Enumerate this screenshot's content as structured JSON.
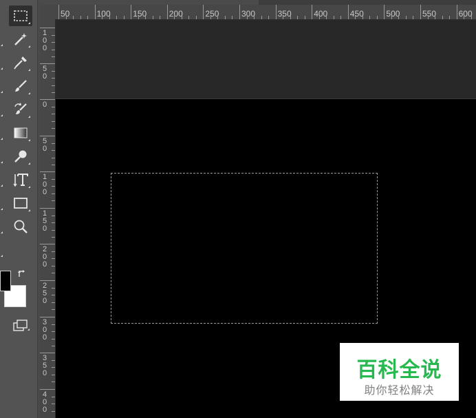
{
  "toolbar": {
    "tools": [
      {
        "name": "rectangular-marquee-tool",
        "icon": "marquee-icon",
        "active": true
      },
      {
        "name": "magic-wand-tool",
        "icon": "magic-wand-icon"
      },
      {
        "name": "eyedropper-tool",
        "icon": "eyedropper-icon"
      },
      {
        "name": "brush-tool",
        "icon": "brush-icon"
      },
      {
        "name": "history-brush-tool",
        "icon": "history-brush-icon"
      },
      {
        "name": "gradient-tool",
        "icon": "gradient-icon"
      },
      {
        "name": "dodge-tool",
        "icon": "dodge-icon"
      },
      {
        "name": "type-tool",
        "icon": "vertical-type-icon"
      },
      {
        "name": "rectangle-tool",
        "icon": "rectangle-icon"
      },
      {
        "name": "zoom-tool",
        "icon": "zoom-icon"
      }
    ],
    "foreground_color": "#000000",
    "background_color": "#ffffff"
  },
  "ruler_top": {
    "labels": [
      "50",
      "100",
      "150",
      "200",
      "250",
      "300",
      "350",
      "400",
      "450",
      "500",
      "550",
      "600"
    ]
  },
  "ruler_left": {
    "labels": [
      "100",
      "50",
      "0",
      "50",
      "100",
      "150",
      "200",
      "250",
      "300",
      "350",
      "400"
    ]
  },
  "canvas": {
    "background": "#000000",
    "pasteboard": "#282828",
    "selection": "marquee-selection"
  },
  "watermark": {
    "title": "百科全说",
    "subtitle": "助你轻松解决",
    "title_color": "#27b94f"
  }
}
